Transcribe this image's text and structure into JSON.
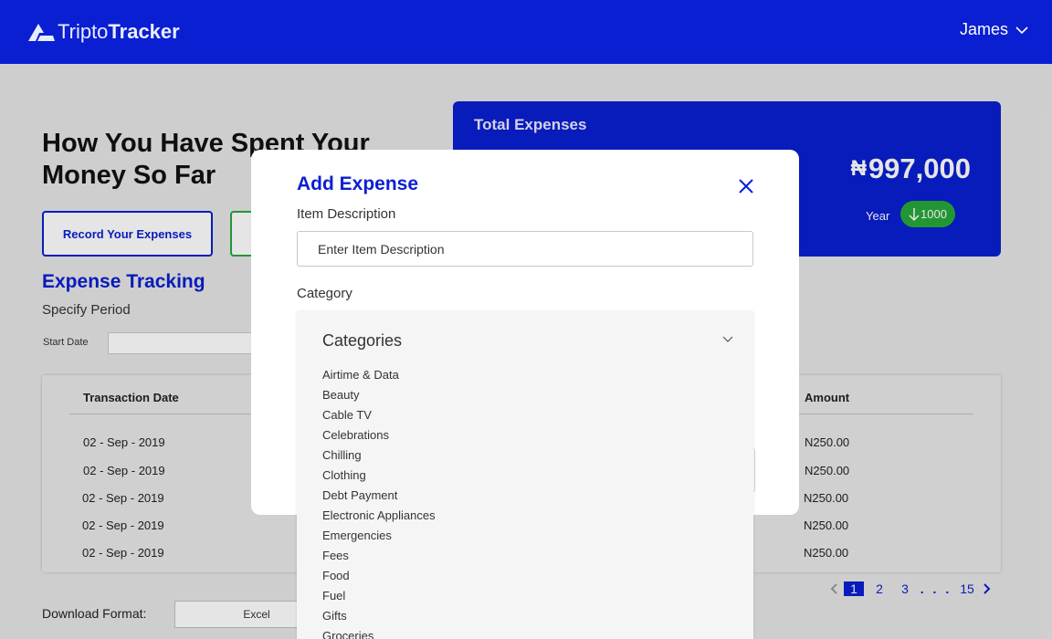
{
  "header": {
    "logo_part1": "Tripto",
    "logo_part2": "Tracker",
    "user_name": "James"
  },
  "main": {
    "heading": "How You Have Spent Your Money So Far",
    "record_button": "Record Your Expenses",
    "section_title": "Expense Tracking",
    "section_subtitle": "Specify Period",
    "start_date_label": "Start Date"
  },
  "total_card": {
    "title": "Total Expenses",
    "currency": "₦",
    "amount": "997,000",
    "period_label": "Year",
    "change_value": "1000",
    "change_direction": "down"
  },
  "table": {
    "columns": {
      "date": "Transaction Date",
      "amount": "Amount"
    },
    "rows": [
      {
        "date": "02 - Sep - 2019",
        "amount": "N250.00"
      },
      {
        "date": "02 - Sep - 2019",
        "amount": "N250.00"
      },
      {
        "date": "02 - Sep - 2019",
        "amount": "N250.00"
      },
      {
        "date": "02 - Sep - 2019",
        "amount": "N250.00"
      },
      {
        "date": "02 - Sep - 2019",
        "amount": "N250.00"
      }
    ]
  },
  "pagination": {
    "pages": [
      "1",
      "2",
      "3"
    ],
    "current": "1",
    "ellipsis": ". . .",
    "last": "15"
  },
  "download": {
    "label": "Download Format:",
    "selected": "Excel"
  },
  "modal": {
    "title": "Add Expense",
    "desc_label": "Item Description",
    "desc_placeholder": "Enter Item Description",
    "category_label": "Category",
    "dropdown_header": "Categories",
    "categories": [
      "Airtime & Data",
      "Beauty",
      "Cable TV",
      "Celebrations",
      "Chilling",
      "Clothing",
      "Debt Payment",
      "Electronic Appliances",
      "Emergencies",
      "Fees",
      "Food",
      "Fuel",
      "Gifts",
      "Groceries"
    ]
  },
  "colors": {
    "primary": "#0a1fd1",
    "accent_green": "#27a83a",
    "background": "#e6e6e6"
  },
  "icons": {
    "logo": "logo-mark-icon",
    "user_menu": "chevron-down-icon",
    "close": "close-icon",
    "trend": "arrow-down-icon",
    "pager_prev": "chevron-left-icon",
    "pager_next": "chevron-right-icon",
    "dropdown": "chevron-down-icon"
  }
}
